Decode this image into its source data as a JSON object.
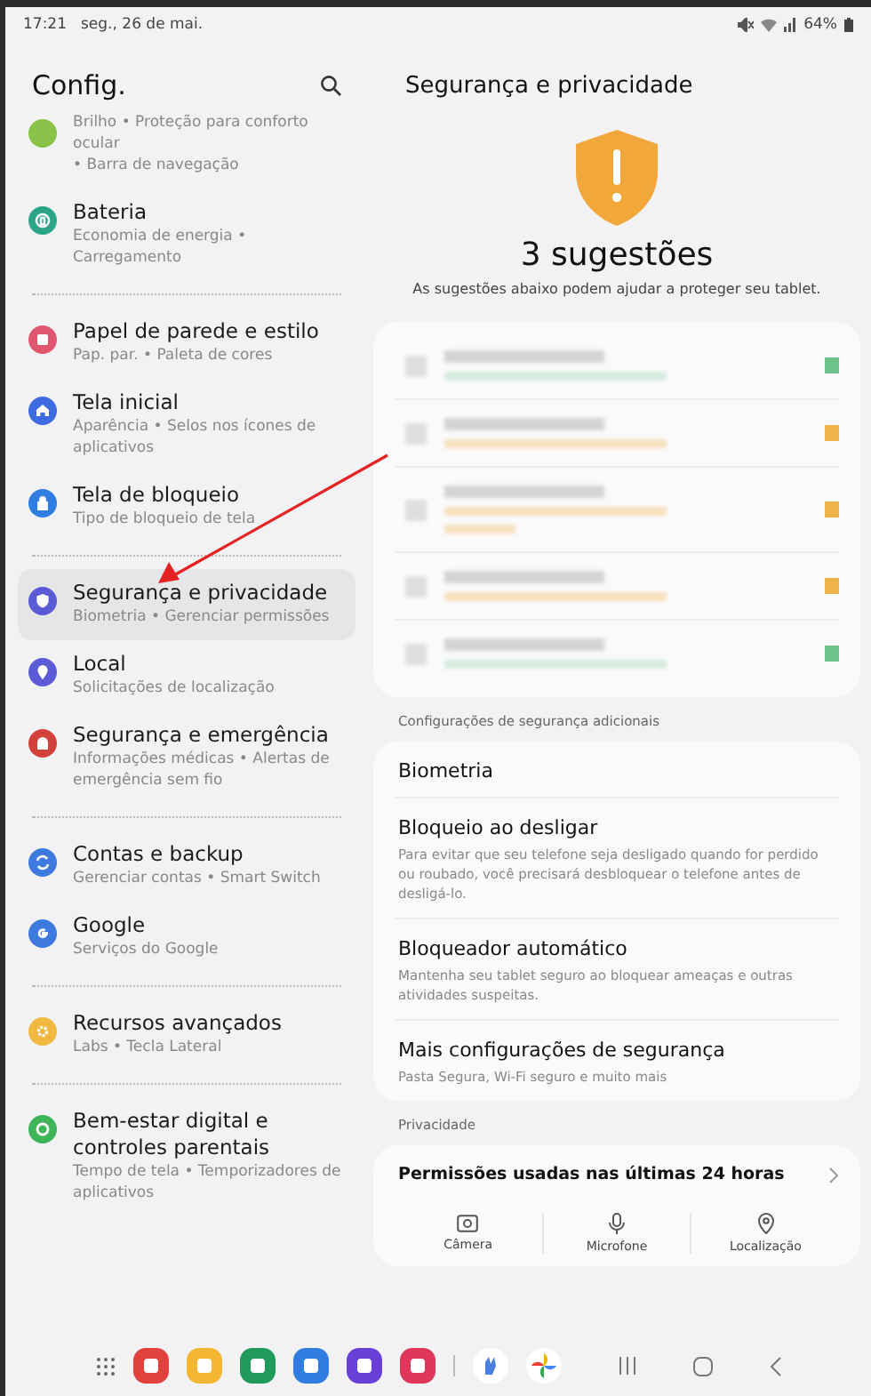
{
  "status_bar": {
    "time": "17:21",
    "date": "seg., 26 de mai.",
    "battery": "64%"
  },
  "sidebar": {
    "title": "Config.",
    "groups": [
      [
        {
          "title": "Brilho • Proteção para conforto ocular",
          "subtitle": "• Barra de navegação",
          "color": "#8bc34a",
          "selected": false,
          "kind": "partial"
        },
        {
          "title": "Bateria",
          "subtitle": "Economia de energia • Carregamento",
          "color": "#2aa58a",
          "selected": false,
          "kind": "battery"
        }
      ],
      [
        {
          "title": "Papel de parede e estilo",
          "subtitle": "Pap. par. • Paleta de cores",
          "color": "#e0566e",
          "selected": false,
          "kind": "wallpaper"
        },
        {
          "title": "Tela inicial",
          "subtitle": "Aparência • Selos nos ícones de aplicativos",
          "color": "#3d6be0",
          "selected": false,
          "kind": "home"
        },
        {
          "title": "Tela de bloqueio",
          "subtitle": "Tipo de bloqueio de tela",
          "color": "#2f7de0",
          "selected": false,
          "kind": "lock"
        }
      ],
      [
        {
          "title": "Segurança e privacidade",
          "subtitle": "Biometria • Gerenciar permissões",
          "color": "#5b5bd6",
          "selected": true,
          "kind": "shield"
        },
        {
          "title": "Local",
          "subtitle": "Solicitações de localização",
          "color": "#5b5bd6",
          "selected": false,
          "kind": "pin"
        },
        {
          "title": "Segurança e emergência",
          "subtitle": "Informações médicas • Alertas de emergência sem fio",
          "color": "#d2423a",
          "selected": false,
          "kind": "siren"
        }
      ],
      [
        {
          "title": "Contas e backup",
          "subtitle": "Gerenciar contas • Smart Switch",
          "color": "#3f7ae0",
          "selected": false,
          "kind": "sync"
        },
        {
          "title": "Google",
          "subtitle": "Serviços do Google",
          "color": "#3f7ae0",
          "selected": false,
          "kind": "google"
        }
      ],
      [
        {
          "title": "Recursos avançados",
          "subtitle": "Labs • Tecla Lateral",
          "color": "#f0b840",
          "selected": false,
          "kind": "gear"
        }
      ],
      [
        {
          "title": "Bem-estar digital e controles parentais",
          "subtitle": "Tempo de tela • Temporizadores de aplicativos",
          "color": "#3fb55a",
          "selected": false,
          "kind": "wellbeing"
        }
      ]
    ]
  },
  "main": {
    "title": "Segurança e privacidade",
    "headline": "3 sugestões",
    "description": "As sugestões abaixo podem ajudar a proteger seu tablet.",
    "suggestions": [
      {
        "color": "#6cc38a"
      },
      {
        "color": "#f0b24a"
      },
      {
        "color": "#f0b24a"
      },
      {
        "color": "#f0b24a"
      },
      {
        "color": "#6cc38a"
      }
    ],
    "additional_header": "Configurações de segurança adicionais",
    "settings": [
      {
        "title": "Biometria"
      },
      {
        "title": "Bloqueio ao desligar",
        "subtitle": "Para evitar que seu telefone seja desligado quando for perdido ou roubado, você precisará desbloquear o telefone antes de desligá-lo."
      },
      {
        "title": "Bloqueador automático",
        "subtitle": "Mantenha seu tablet seguro ao bloquear ameaças e outras atividades suspeitas."
      },
      {
        "title": "Mais configurações de segurança",
        "subtitle": "Pasta Segura, Wi-Fi seguro e muito mais"
      }
    ],
    "privacy_header": "Privacidade",
    "permissions": {
      "title": "Permissões usadas nas últimas 24 horas",
      "items": [
        {
          "label": "Câmera",
          "kind": "camera"
        },
        {
          "label": "Microfone",
          "kind": "mic"
        },
        {
          "label": "Localização",
          "kind": "location"
        }
      ]
    }
  }
}
